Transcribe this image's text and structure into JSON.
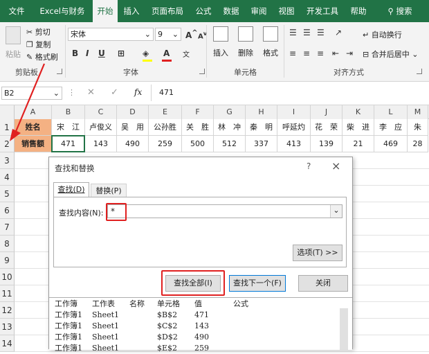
{
  "tabs": [
    "文件",
    "Excel与财务",
    "开始",
    "插入",
    "页面布局",
    "公式",
    "数据",
    "审阅",
    "视图",
    "开发工具",
    "帮助",
    "搜索"
  ],
  "ribbon": {
    "clipboard": {
      "paste": "粘贴",
      "cut": "剪切",
      "copy": "复制",
      "format_painter": "格式刷",
      "label": "剪贴板"
    },
    "font": {
      "name": "宋体",
      "size": "9",
      "label": "字体",
      "bold": "B",
      "italic": "I",
      "underline": "U",
      "grow": "A",
      "shrink": "A",
      "font_color": "A"
    },
    "cells": {
      "insert": "插入",
      "delete": "删除",
      "format": "格式",
      "label": "单元格"
    },
    "align": {
      "wrap": "自动换行",
      "merge": "合并后居中",
      "label": "对齐方式"
    }
  },
  "formula_bar": {
    "name_box": "B2",
    "value": "471",
    "fx": "fx"
  },
  "columns": [
    "A",
    "B",
    "C",
    "D",
    "E",
    "F",
    "G",
    "H",
    "I",
    "J",
    "K",
    "L",
    "M"
  ],
  "rows": [
    "1",
    "2",
    "3",
    "4",
    "5",
    "6",
    "7",
    "8",
    "9",
    "10",
    "11",
    "12",
    "13",
    "14"
  ],
  "sheet": {
    "row1": [
      "姓名",
      "宋　江",
      "卢俊义",
      "吴　用",
      "公孙胜",
      "关　胜",
      "林　冲",
      "秦　明",
      "呼延灼",
      "花　荣",
      "柴　进",
      "李　应",
      "朱"
    ],
    "row2": [
      "销售额",
      "471",
      "143",
      "490",
      "259",
      "500",
      "512",
      "337",
      "413",
      "139",
      "21",
      "469",
      "28"
    ]
  },
  "dialog": {
    "title": "查找和替换",
    "help": "?",
    "close": "×",
    "tab_find": "查找(D)",
    "tab_replace": "替换(P)",
    "find_label": "查找内容(N):",
    "find_value": "*",
    "options_btn": "选项(T) >>",
    "find_all": "查找全部(I)",
    "find_next": "查找下一个(F)",
    "close_btn": "关闭",
    "result_headers": [
      "工作簿",
      "工作表",
      "名称",
      "单元格",
      "值",
      "公式"
    ],
    "results": [
      [
        "工作簿1",
        "Sheet1",
        "",
        "$B$2",
        "471",
        ""
      ],
      [
        "工作簿1",
        "Sheet1",
        "",
        "$C$2",
        "143",
        ""
      ],
      [
        "工作簿1",
        "Sheet1",
        "",
        "$D$2",
        "490",
        ""
      ],
      [
        "工作簿1",
        "Sheet1",
        "",
        "$E$2",
        "259",
        ""
      ]
    ]
  },
  "colors": {
    "excel_green": "#217346",
    "header_fill": "#f4b183",
    "highlight_red": "#e02020"
  }
}
